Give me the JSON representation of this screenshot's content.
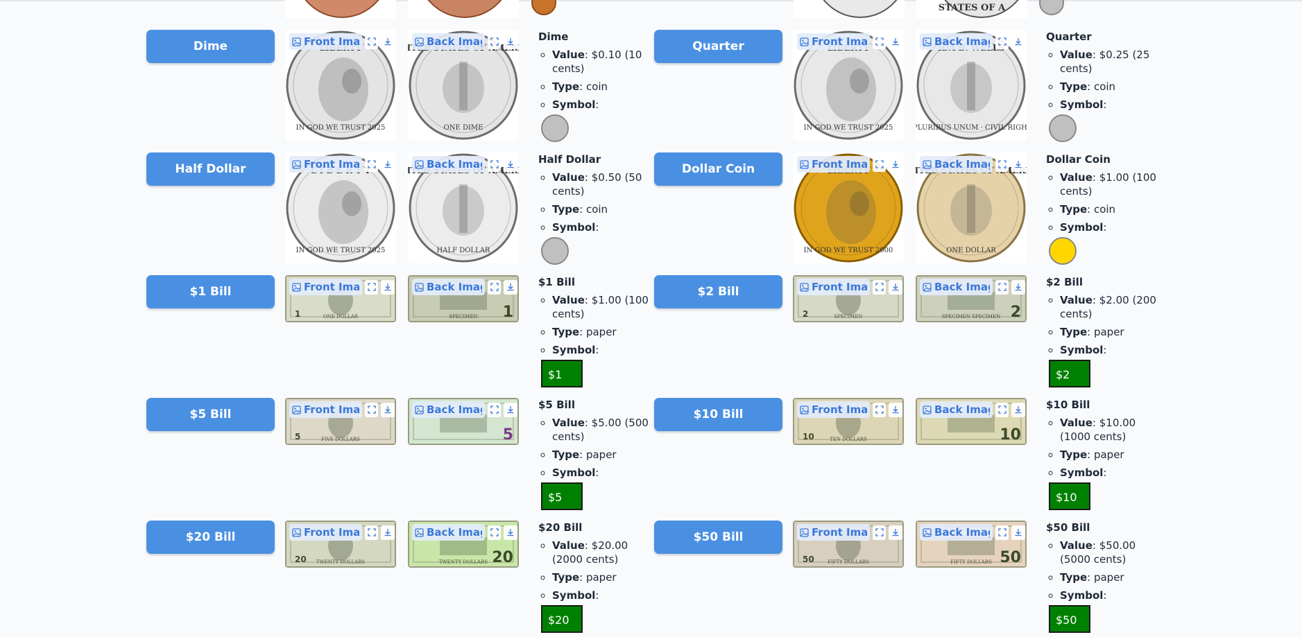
{
  "labels": {
    "front": "Front Image",
    "back": "Back Image",
    "value": "Value",
    "type": "Type",
    "symbol": "Symbol"
  },
  "top_partial": {
    "left_back_text": "",
    "right_back_text": "STATES OF A"
  },
  "left_column": [
    {
      "name": "Dime",
      "value_text": "$0.10 (10 cents)",
      "type": "coin",
      "symbol": {
        "kind": "coin",
        "color": "#c0c0c0",
        "label": ""
      },
      "front_text": {
        "top": "LIBERTY",
        "bottom": "IN GOD WE TRUST  2025"
      },
      "back_text": {
        "top": "UNITED STATES OF AMERICA",
        "bottom": "ONE DIME"
      }
    },
    {
      "name": "Half Dollar",
      "value_text": "$0.50 (50 cents)",
      "type": "coin",
      "symbol": {
        "kind": "coin",
        "color": "#c0c0c0",
        "label": ""
      },
      "front_text": {
        "top": "L I B E R T Y",
        "bottom": "IN GOD WE TRUST 2025"
      },
      "back_text": {
        "top": "UNITED STATES OF AMERICA",
        "bottom": "HALF DOLLAR"
      }
    },
    {
      "name": "$1 Bill",
      "value_text": "$1.00 (100 cents)",
      "type": "paper",
      "symbol": {
        "kind": "bill",
        "color": "#008000",
        "label": "$1"
      },
      "bill_corner": "1",
      "bill_front_caption": "ONE DOLLAR",
      "bill_back_caption": "SPECIMEN"
    },
    {
      "name": "$5 Bill",
      "value_text": "$5.00 (500 cents)",
      "type": "paper",
      "symbol": {
        "kind": "bill",
        "color": "#008000",
        "label": "$5"
      },
      "bill_corner": "5",
      "bill_front_caption": "FIVE DOLLARS",
      "bill_back_caption": ""
    },
    {
      "name": "$20 Bill",
      "value_text": "$20.00 (2000 cents)",
      "type": "paper",
      "symbol": {
        "kind": "bill",
        "color": "#008000",
        "label": "$20"
      },
      "bill_corner": "20",
      "bill_front_caption": "TWENTY DOLLARS",
      "bill_back_caption": "TWENTY DOLLARS"
    }
  ],
  "right_column": [
    {
      "name": "Quarter",
      "value_text": "$0.25 (25 cents)",
      "type": "coin",
      "symbol": {
        "kind": "coin",
        "color": "#c0c0c0",
        "label": ""
      },
      "front_text": {
        "top": "LIBERTY",
        "bottom": "IN GOD WE TRUST 2025"
      },
      "back_text": {
        "top": "IDA B. WELLS",
        "bottom": "E PLURIBUS UNUM · CIVIL RIGHTS"
      }
    },
    {
      "name": "Dollar Coin",
      "value_text": "$1.00 (100 cents)",
      "type": "coin",
      "symbol": {
        "kind": "coin",
        "color": "#ffd700",
        "label": ""
      },
      "front_text": {
        "top": "LIBERTY",
        "bottom": "IN GOD WE TRUST 2000"
      },
      "back_text": {
        "top": "UNITED STATES OF AMERICA",
        "bottom": "ONE DOLLAR"
      }
    },
    {
      "name": "$2 Bill",
      "value_text": "$2.00 (200 cents)",
      "type": "paper",
      "symbol": {
        "kind": "bill",
        "color": "#008000",
        "label": "$2"
      },
      "bill_corner": "2",
      "bill_front_caption": "SPECIMEN",
      "bill_back_caption": "SPECIMEN SPECIMEN"
    },
    {
      "name": "$10 Bill",
      "value_text": "$10.00 (1000 cents)",
      "type": "paper",
      "symbol": {
        "kind": "bill",
        "color": "#008000",
        "label": "$10"
      },
      "bill_corner": "10",
      "bill_front_caption": "TEN DOLLARS",
      "bill_back_caption": ""
    },
    {
      "name": "$50 Bill",
      "value_text": "$50.00 (5000 cents)",
      "type": "paper",
      "symbol": {
        "kind": "bill",
        "color": "#008000",
        "label": "$50"
      },
      "bill_corner": "50",
      "bill_front_caption": "FIFTY DOLLARS",
      "bill_back_caption": "FIFTY DOLLARS"
    }
  ]
}
